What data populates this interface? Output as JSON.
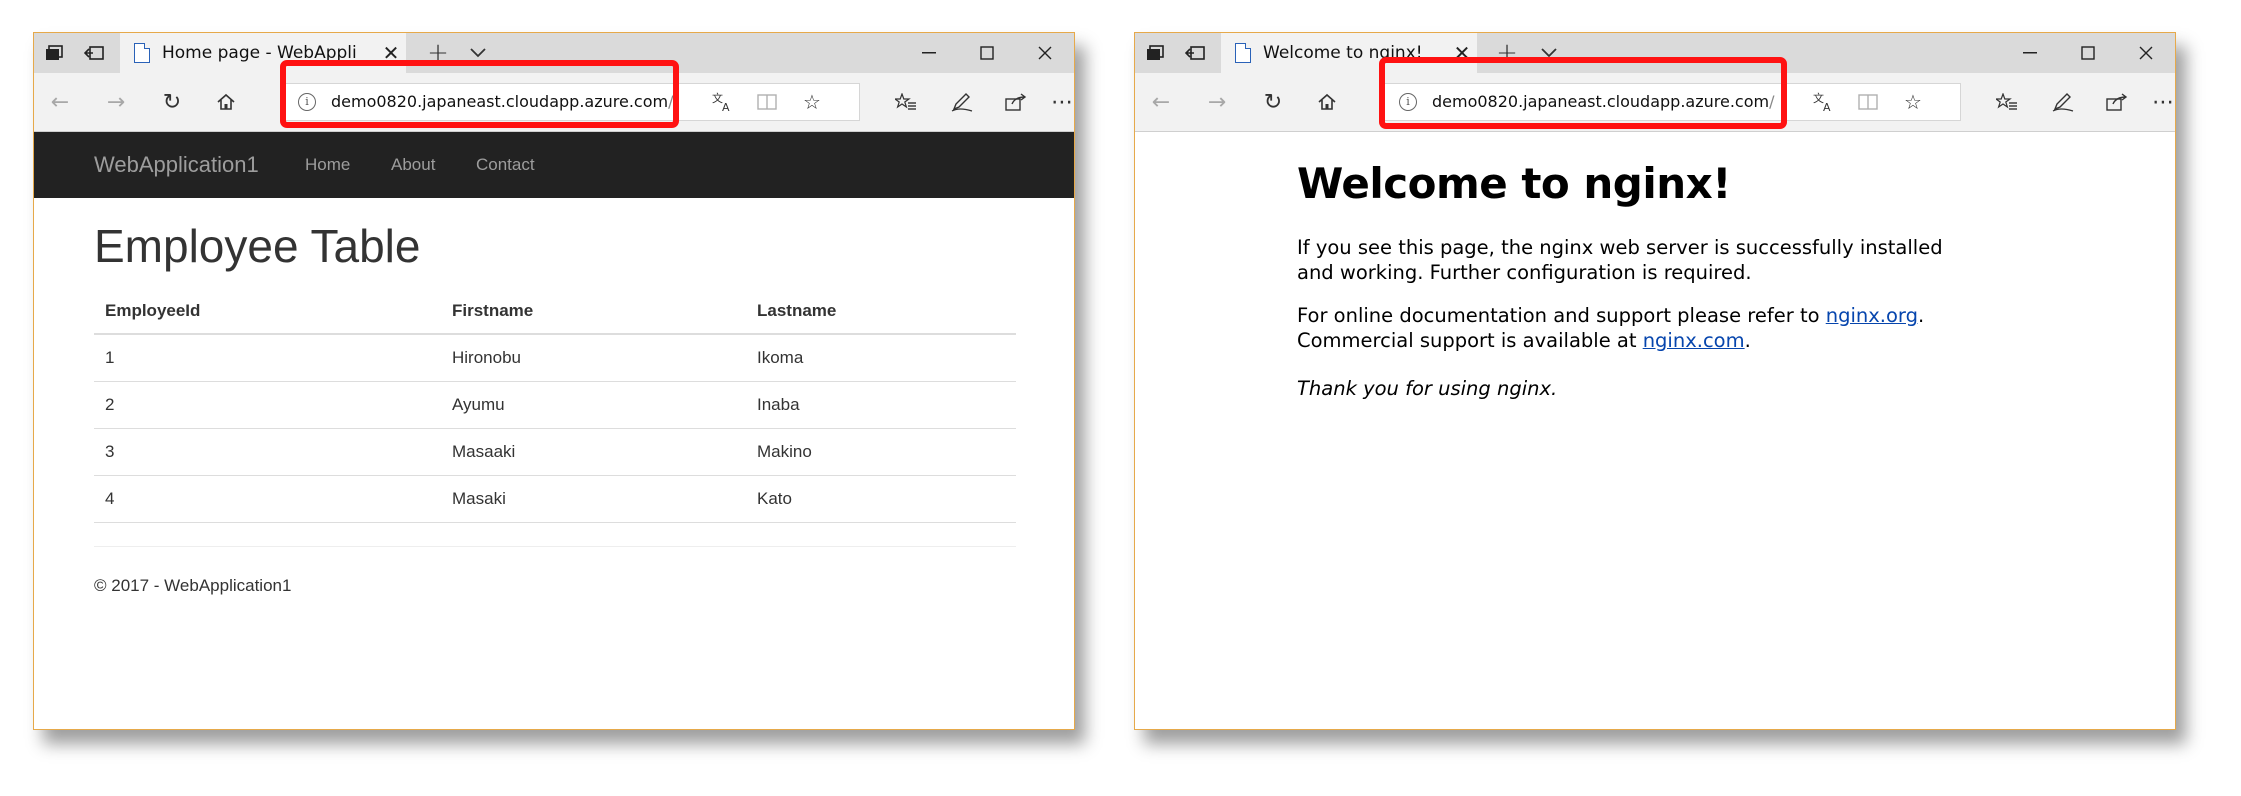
{
  "left_window": {
    "tab_title": "Home page - WebAppli",
    "url_host": "demo0820.japaneast.cloudapp.azure.com",
    "url_path": "/",
    "site": {
      "brand": "WebApplication1",
      "nav": [
        "Home",
        "About",
        "Contact"
      ],
      "heading": "Employee Table",
      "table": {
        "headers": [
          "EmployeeId",
          "Firstname",
          "Lastname"
        ],
        "rows": [
          [
            "1",
            "Hironobu",
            "Ikoma"
          ],
          [
            "2",
            "Ayumu",
            "Inaba"
          ],
          [
            "3",
            "Masaaki",
            "Makino"
          ],
          [
            "4",
            "Masaki",
            "Kato"
          ]
        ]
      },
      "footer": "© 2017 - WebApplication1"
    }
  },
  "right_window": {
    "tab_title": "Welcome to nginx!",
    "url_host": "demo0820.japaneast.cloudapp.azure.com",
    "url_path": "/",
    "page": {
      "heading": "Welcome to nginx!",
      "p1": "If you see this page, the nginx web server is successfully installed and working. Further configuration is required.",
      "p2_text1": "For online documentation and support please refer to ",
      "p2_link1": "nginx.org",
      "p2_text2": ".",
      "p2_text3": "Commercial support is available at ",
      "p2_link2": "nginx.com",
      "p2_text4": ".",
      "p3": "Thank you for using nginx."
    }
  },
  "icons": {
    "tab_actions": "tab-actions-icon",
    "set_aside": "set-aside-tabs-icon",
    "new_tab": "plus-icon",
    "tab_list": "chevron-down-icon",
    "minimize": "minimize-icon",
    "maximize": "maximize-icon",
    "close": "close-icon",
    "back": "back-arrow-icon",
    "forward": "forward-arrow-icon",
    "refresh": "refresh-icon",
    "home": "home-icon",
    "site_info": "info-icon",
    "translate": "translate-icon",
    "reading_view": "reading-view-icon",
    "favorite": "star-icon",
    "favorites_hub": "favorites-hub-icon",
    "notes": "pen-icon",
    "share": "share-icon",
    "more": "more-icon"
  },
  "colors": {
    "highlight": "#ff1212",
    "window_border": "#e6a94a",
    "site_nav_bg": "#222222",
    "link": "#0645ad"
  }
}
